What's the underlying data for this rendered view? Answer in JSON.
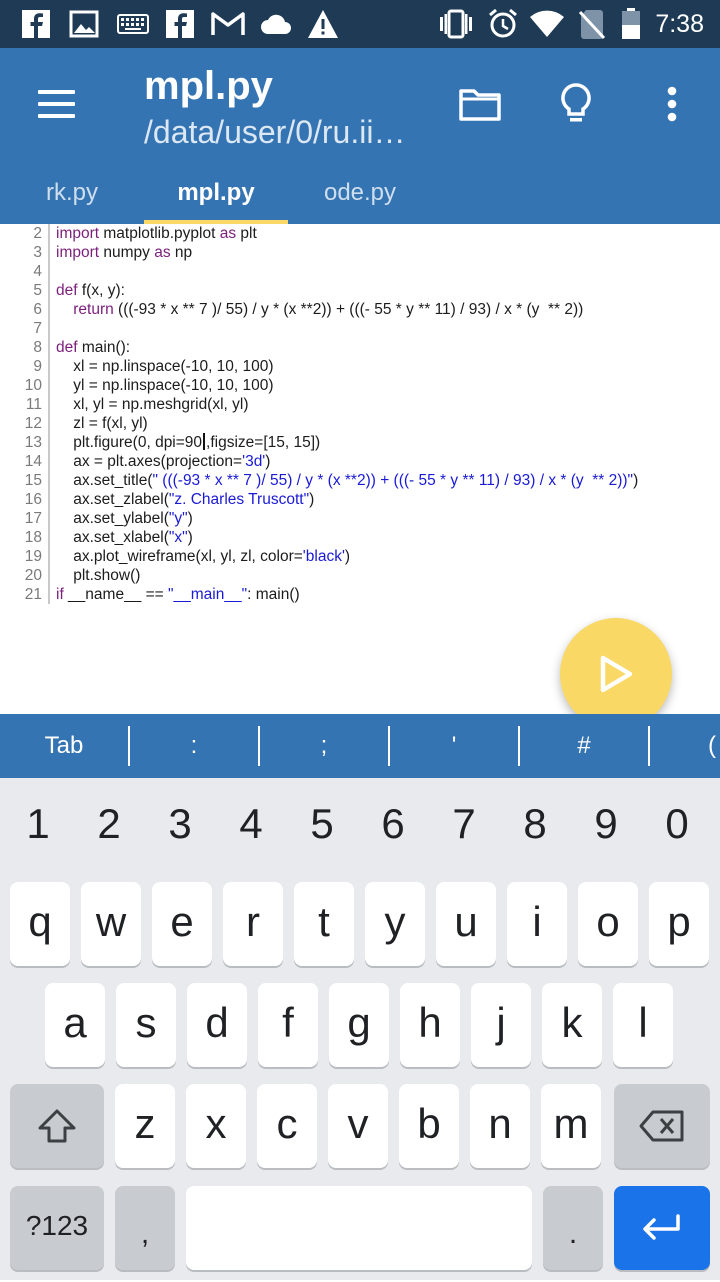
{
  "status_bar": {
    "time": "7:38",
    "left_icons": [
      "facebook-icon",
      "image-icon",
      "keyboard-icon",
      "facebook-icon",
      "gmail-icon",
      "cloud-icon",
      "warning-icon"
    ],
    "right_icons": [
      "vibrate-icon",
      "alarm-icon",
      "wifi-icon",
      "no-sim-icon",
      "battery-icon"
    ]
  },
  "app_bar": {
    "title": "mpl.py",
    "subtitle": "/data/user/0/ru.ii…",
    "color": "#3574b3"
  },
  "tabs": [
    {
      "label": "rk.py",
      "active": false
    },
    {
      "label": "mpl.py",
      "active": true
    },
    {
      "label": "ode.py",
      "active": false
    }
  ],
  "editor": {
    "lines": [
      {
        "n": "2",
        "text": "import matplotlib.pyplot as plt"
      },
      {
        "n": "3",
        "text": "import numpy as np"
      },
      {
        "n": "4",
        "text": ""
      },
      {
        "n": "5",
        "text": "def f(x, y):"
      },
      {
        "n": "6",
        "text": "    return (((-93 * x ** 7 )/ 55) / y * (x **2)) + (((- 55 * y ** 11) / 93) / x * (y  ** 2))"
      },
      {
        "n": "7",
        "text": ""
      },
      {
        "n": "8",
        "text": "def main():"
      },
      {
        "n": "9",
        "text": "    xl = np.linspace(-10, 10, 100)"
      },
      {
        "n": "10",
        "text": "    yl = np.linspace(-10, 10, 100)"
      },
      {
        "n": "11",
        "text": "    xl, yl = np.meshgrid(xl, yl)"
      },
      {
        "n": "12",
        "text": "    zl = f(xl, yl)"
      },
      {
        "n": "13",
        "text": "    plt.figure(0, dpi=90,figsize=[15, 15])"
      },
      {
        "n": "14",
        "text": "    ax = plt.axes(projection='3d')"
      },
      {
        "n": "15",
        "text": "    ax.set_title(\" (((-93 * x ** 7 )/ 55) / y * (x **2)) + (((- 55 * y ** 11) / 93) / x * (y  ** 2))\")"
      },
      {
        "n": "16",
        "text": "    ax.set_zlabel(\"z. Charles Truscott\")"
      },
      {
        "n": "17",
        "text": "    ax.set_ylabel(\"y\")"
      },
      {
        "n": "18",
        "text": "    ax.set_xlabel(\"x\")"
      },
      {
        "n": "19",
        "text": "    ax.plot_wireframe(xl, yl, zl, color='black')"
      },
      {
        "n": "20",
        "text": "    plt.show()"
      },
      {
        "n": "21",
        "text": "if __name__ == \"__main__\": main()"
      }
    ],
    "cursor_line": "13"
  },
  "fab": {
    "icon": "play-icon",
    "color": "#f9d865"
  },
  "extra_keys": [
    "Tab",
    ":",
    ";",
    "'",
    "#",
    "("
  ],
  "keyboard": {
    "number_row": [
      "1",
      "2",
      "3",
      "4",
      "5",
      "6",
      "7",
      "8",
      "9",
      "0"
    ],
    "row1": [
      "q",
      "w",
      "e",
      "r",
      "t",
      "y",
      "u",
      "i",
      "o",
      "p"
    ],
    "row2": [
      "a",
      "s",
      "d",
      "f",
      "g",
      "h",
      "j",
      "k",
      "l"
    ],
    "row3": [
      "z",
      "x",
      "c",
      "v",
      "b",
      "n",
      "m"
    ],
    "symbols_label": "?123",
    "comma": ",",
    "period": ".",
    "enter_color": "#1a73e8"
  }
}
